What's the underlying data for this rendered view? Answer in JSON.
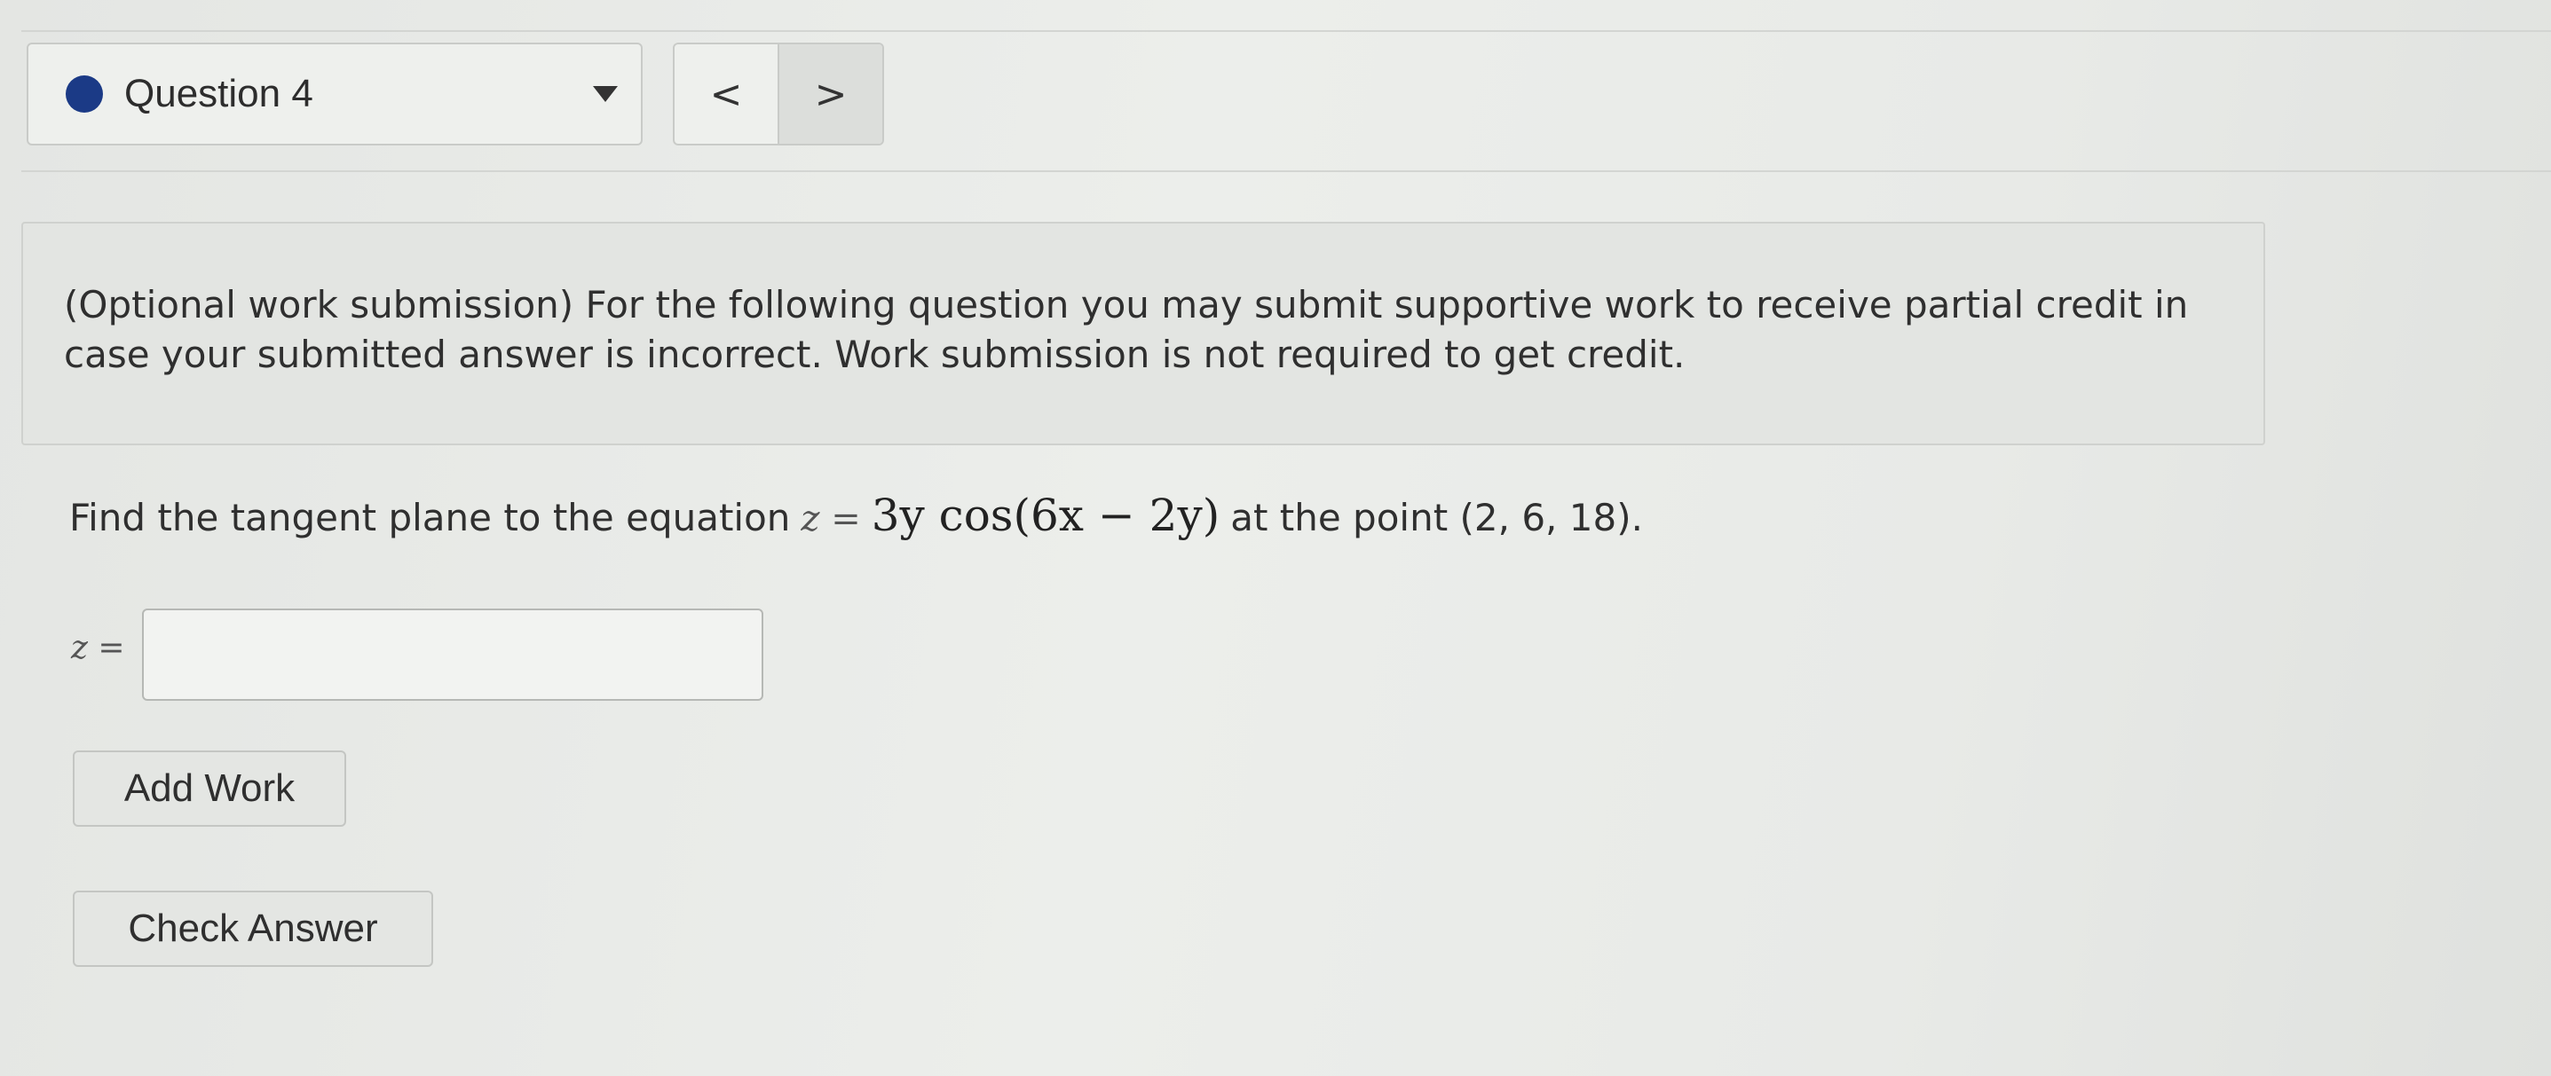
{
  "nav": {
    "question_label": "Question 4",
    "prev_glyph": "<",
    "next_glyph": ">"
  },
  "info": {
    "text": "(Optional work submission) For the following question you may submit supportive work to receive partial credit in case your submitted answer is incorrect.  Work submission is not required to get credit."
  },
  "question": {
    "prefix": "Find the tangent plane to the equation",
    "equation_lhs": "z =",
    "equation_rhs": "3y cos(6x − 2y)",
    "suffix": "at the point (2, 6, 18)."
  },
  "answer": {
    "label": "z =",
    "value": ""
  },
  "buttons": {
    "add_work": "Add Work",
    "check_answer": "Check Answer"
  },
  "colors": {
    "status_dot": "#1b3a86"
  },
  "icons": {
    "status": "status-dot-icon",
    "dropdown": "dropdown-arrow-icon",
    "prev": "chevron-left-icon",
    "next": "chevron-right-icon"
  }
}
